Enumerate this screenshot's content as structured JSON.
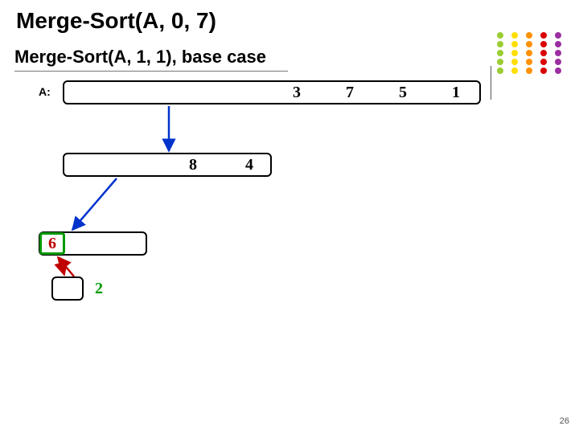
{
  "title": "Merge-Sort(A, 0, 7)",
  "subtitle_call": "Merge-Sort(A, 1, 1)",
  "subtitle_note": ", base case",
  "a_label": "A:",
  "top_values": {
    "v4": "3",
    "v5": "7",
    "v6": "5",
    "v7": "1"
  },
  "mid_values": {
    "v2": "8",
    "v3": "4"
  },
  "leaf_value": "6",
  "last_leaf_value": "2",
  "page_number": "26",
  "colors": {
    "red": "#c00000",
    "blue": "#0033cc",
    "green": "#009a00",
    "dot_grid": [
      "#9acd32",
      "#ffde00",
      "#ff9100",
      "#da0000",
      "#9b2fa0"
    ]
  }
}
